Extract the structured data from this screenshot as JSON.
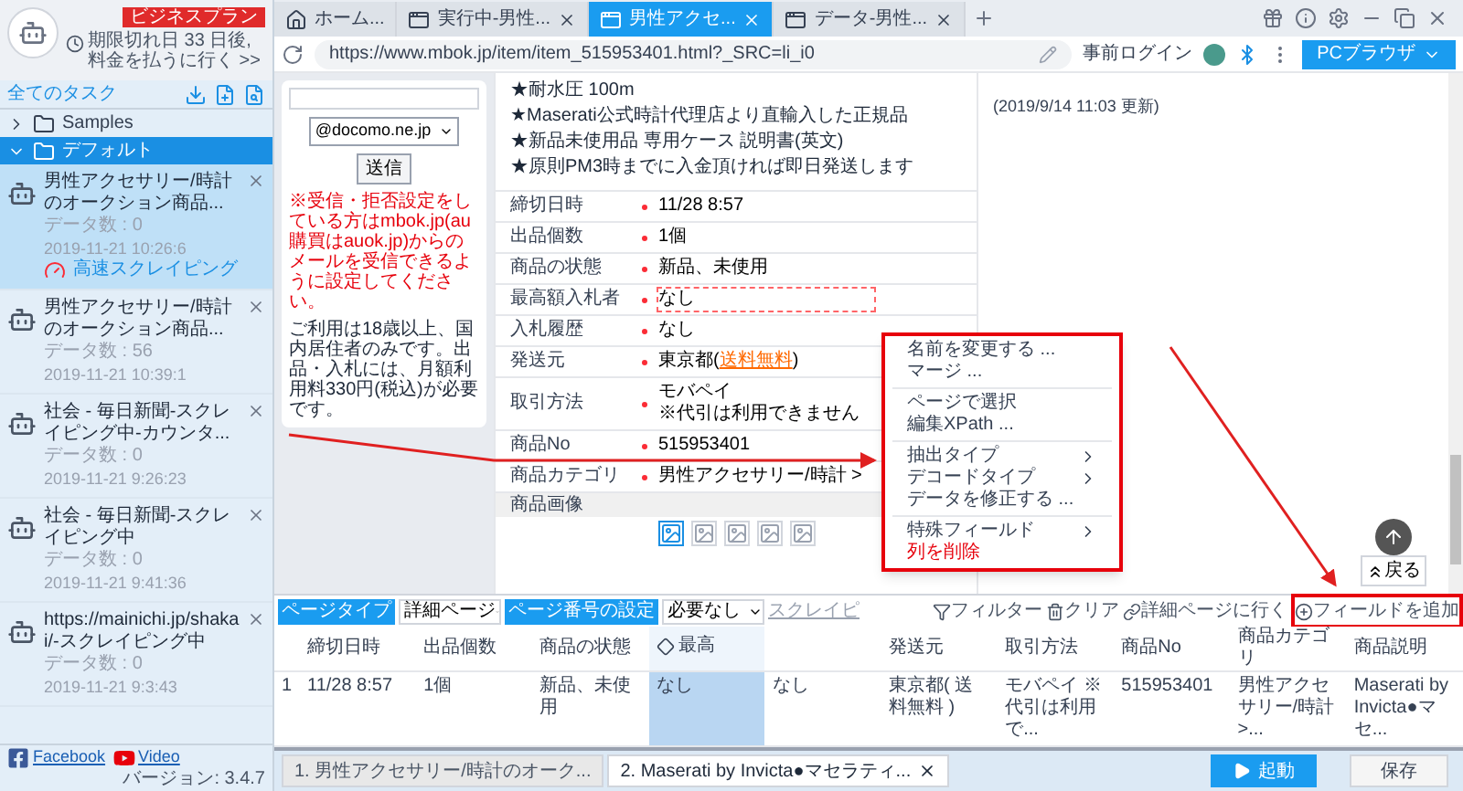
{
  "account": {
    "plan_badge": "ビジネスプラン",
    "expiry": "期限切れ日 33 日後, 料金を払うに行く >>"
  },
  "task_panel": {
    "title": "全てのタスク",
    "tree": [
      {
        "label": "Samples",
        "expanded": false,
        "selected": false
      },
      {
        "label": "デフォルト",
        "expanded": true,
        "selected": true,
        "children": [
          {
            "name": "男性アクセサリー/時計のオークション商品...",
            "count_label": "データ数 :",
            "count": "0",
            "time": "2019-11-21 10:26:6",
            "selected": true,
            "badge": "高速スクレイピング"
          },
          {
            "name": "男性アクセサリー/時計のオークション商品...",
            "count_label": "データ数 :",
            "count": "56",
            "time": "2019-11-21 10:39:1",
            "selected": false
          },
          {
            "name": "社会 - 毎日新聞-スクレイピング中-カウンタ...",
            "count_label": "データ数 :",
            "count": "0",
            "time": "2019-11-21 9:26:23",
            "selected": false
          },
          {
            "name": "社会 - 毎日新聞-スクレイピング中",
            "count_label": "データ数 :",
            "count": "0",
            "time": "2019-11-21 9:41:36",
            "selected": false
          },
          {
            "name": "https://mainichi.jp/shakai/-スクレイピング中",
            "count_label": "データ数 :",
            "count": "0",
            "time": "2019-11-21 9:3:43",
            "selected": false
          }
        ]
      }
    ]
  },
  "footer": {
    "links": [
      {
        "kind": "facebook",
        "label": "Facebook"
      },
      {
        "kind": "video",
        "label": "Video"
      }
    ],
    "version": "バージョン: 3.4.7"
  },
  "tabs": [
    {
      "kind": "home",
      "label": "ホーム...",
      "selected": false
    },
    {
      "kind": "page",
      "label": "実行中-男性...",
      "selected": false
    },
    {
      "kind": "page",
      "label": "男性アクセ...",
      "selected": true
    },
    {
      "kind": "page",
      "label": "データ-男性...",
      "selected": false
    }
  ],
  "address_bar": {
    "url": "https://www.mbok.jp/item/item_515953401.html?_SRC=li_i0",
    "login": "事前ログイン",
    "browser_button": "PCブラウザ"
  },
  "web_page": {
    "form": {
      "select": "@docomo.ne.jp",
      "submit": "送信"
    },
    "notice": "※受信・拒否設定をしている方はmbok.jp(au購買はauok.jp)からのメールを受信できるように設定してください。",
    "terms": "ご利用は18歳以上、国内居住者のみです。出品・入札には、月額利用料330円(税込)が必要です。",
    "description": [
      "★耐水圧 100m",
      "★Maserati公式時計代理店より直輸入した正規品",
      "★新品未使用品 専用ケース 説明書(英文)",
      "★原則PM3時までに入金頂ければ即日発送します"
    ],
    "details": [
      {
        "label": "締切日時",
        "values": [
          "11/28 8:57"
        ],
        "highlighted": false
      },
      {
        "label": "出品個数",
        "values": [
          "1個"
        ],
        "highlighted": false
      },
      {
        "label": "商品の状態",
        "values": [
          "新品、未使用"
        ],
        "highlighted": false
      },
      {
        "label": "最高額入札者",
        "values": [
          "なし"
        ],
        "highlighted": true
      },
      {
        "label": "入札履歴",
        "values": [
          "なし"
        ],
        "highlighted": false
      },
      {
        "label": "発送元",
        "values": [
          "東京都("
        ],
        "link": "送料無料",
        "suffix": ")",
        "highlighted": false
      },
      {
        "label": "取引方法",
        "values": [
          "モバペイ",
          "※代引は利用できません"
        ],
        "highlighted": false
      },
      {
        "label": "商品No",
        "values": [
          "515953401"
        ],
        "highlighted": false
      },
      {
        "label": "商品カテゴリ",
        "values": [
          "男性アクセサリー/時計 >"
        ],
        "highlighted": false
      }
    ],
    "images_title": "商品画像",
    "thumbnails": [
      {
        "selected": true
      },
      {
        "selected": false
      },
      {
        "selected": false
      },
      {
        "selected": false
      },
      {
        "selected": false
      }
    ],
    "updated": "(2019/9/14 11:03 更新)",
    "back": "戻る"
  },
  "context_menu": [
    {
      "kind": "item",
      "label": "名前を変更する ..."
    },
    {
      "kind": "item",
      "label": "マージ ..."
    },
    {
      "kind": "divider"
    },
    {
      "kind": "item",
      "label": "ページで選択"
    },
    {
      "kind": "item",
      "label": "編集XPath ..."
    },
    {
      "kind": "divider"
    },
    {
      "kind": "submenu",
      "label": "抽出タイプ"
    },
    {
      "kind": "submenu",
      "label": "デコードタイプ"
    },
    {
      "kind": "item",
      "label": "データを修正する ..."
    },
    {
      "kind": "divider"
    },
    {
      "kind": "submenu",
      "label": "特殊フィールド"
    },
    {
      "kind": "danger",
      "label": "列を削除"
    }
  ],
  "toolbar": {
    "page_type_label": "ページタイプ",
    "page_type": "詳細ページ",
    "paging_label": "ページ番号の設定",
    "paging": "必要なし",
    "scraping": "スクレイピ",
    "actions": [
      {
        "kind": "filter",
        "label": "フィルター"
      },
      {
        "kind": "clear",
        "label": "クリア"
      },
      {
        "kind": "link",
        "label": "詳細ページに行く"
      },
      {
        "kind": "add",
        "label": "フィールドを追加"
      }
    ]
  },
  "table": {
    "columns": [
      {
        "kind": "index",
        "selected": false
      },
      {
        "kind": "text",
        "label": "締切日時",
        "selected": false
      },
      {
        "kind": "text",
        "label": "出品個数",
        "selected": false
      },
      {
        "kind": "text",
        "label": "商品の状態",
        "selected": false
      },
      {
        "kind": "sort",
        "label": "最高",
        "selected": true
      },
      {
        "kind": "covered",
        "selected": false
      },
      {
        "kind": "text",
        "label": "発送元",
        "selected": false
      },
      {
        "kind": "text",
        "label": "取引方法",
        "selected": false
      },
      {
        "kind": "text",
        "label": "商品No",
        "selected": false
      },
      {
        "kind": "text",
        "label": "商品カテゴリ",
        "selected": false
      },
      {
        "kind": "text",
        "label": "商品説明",
        "selected": false
      }
    ],
    "rows": [
      [
        "1",
        "11/28 8:57",
        "1個",
        "新品、未使用",
        "なし",
        "なし",
        "東京都( 送料無料 )",
        "モバペイ ※代引は利用で...",
        "515953401",
        "男性アクセサリー/時計 >...",
        "Maserati by Invicta●マセ..."
      ]
    ]
  },
  "steps": [
    {
      "label": "1. 男性アクセサリー/時計のオーク...",
      "selected": false
    },
    {
      "label": "2. Maserati by Invicta●マセラティ...",
      "selected": true
    }
  ],
  "buttons": {
    "run": "起動",
    "save": "保存"
  }
}
